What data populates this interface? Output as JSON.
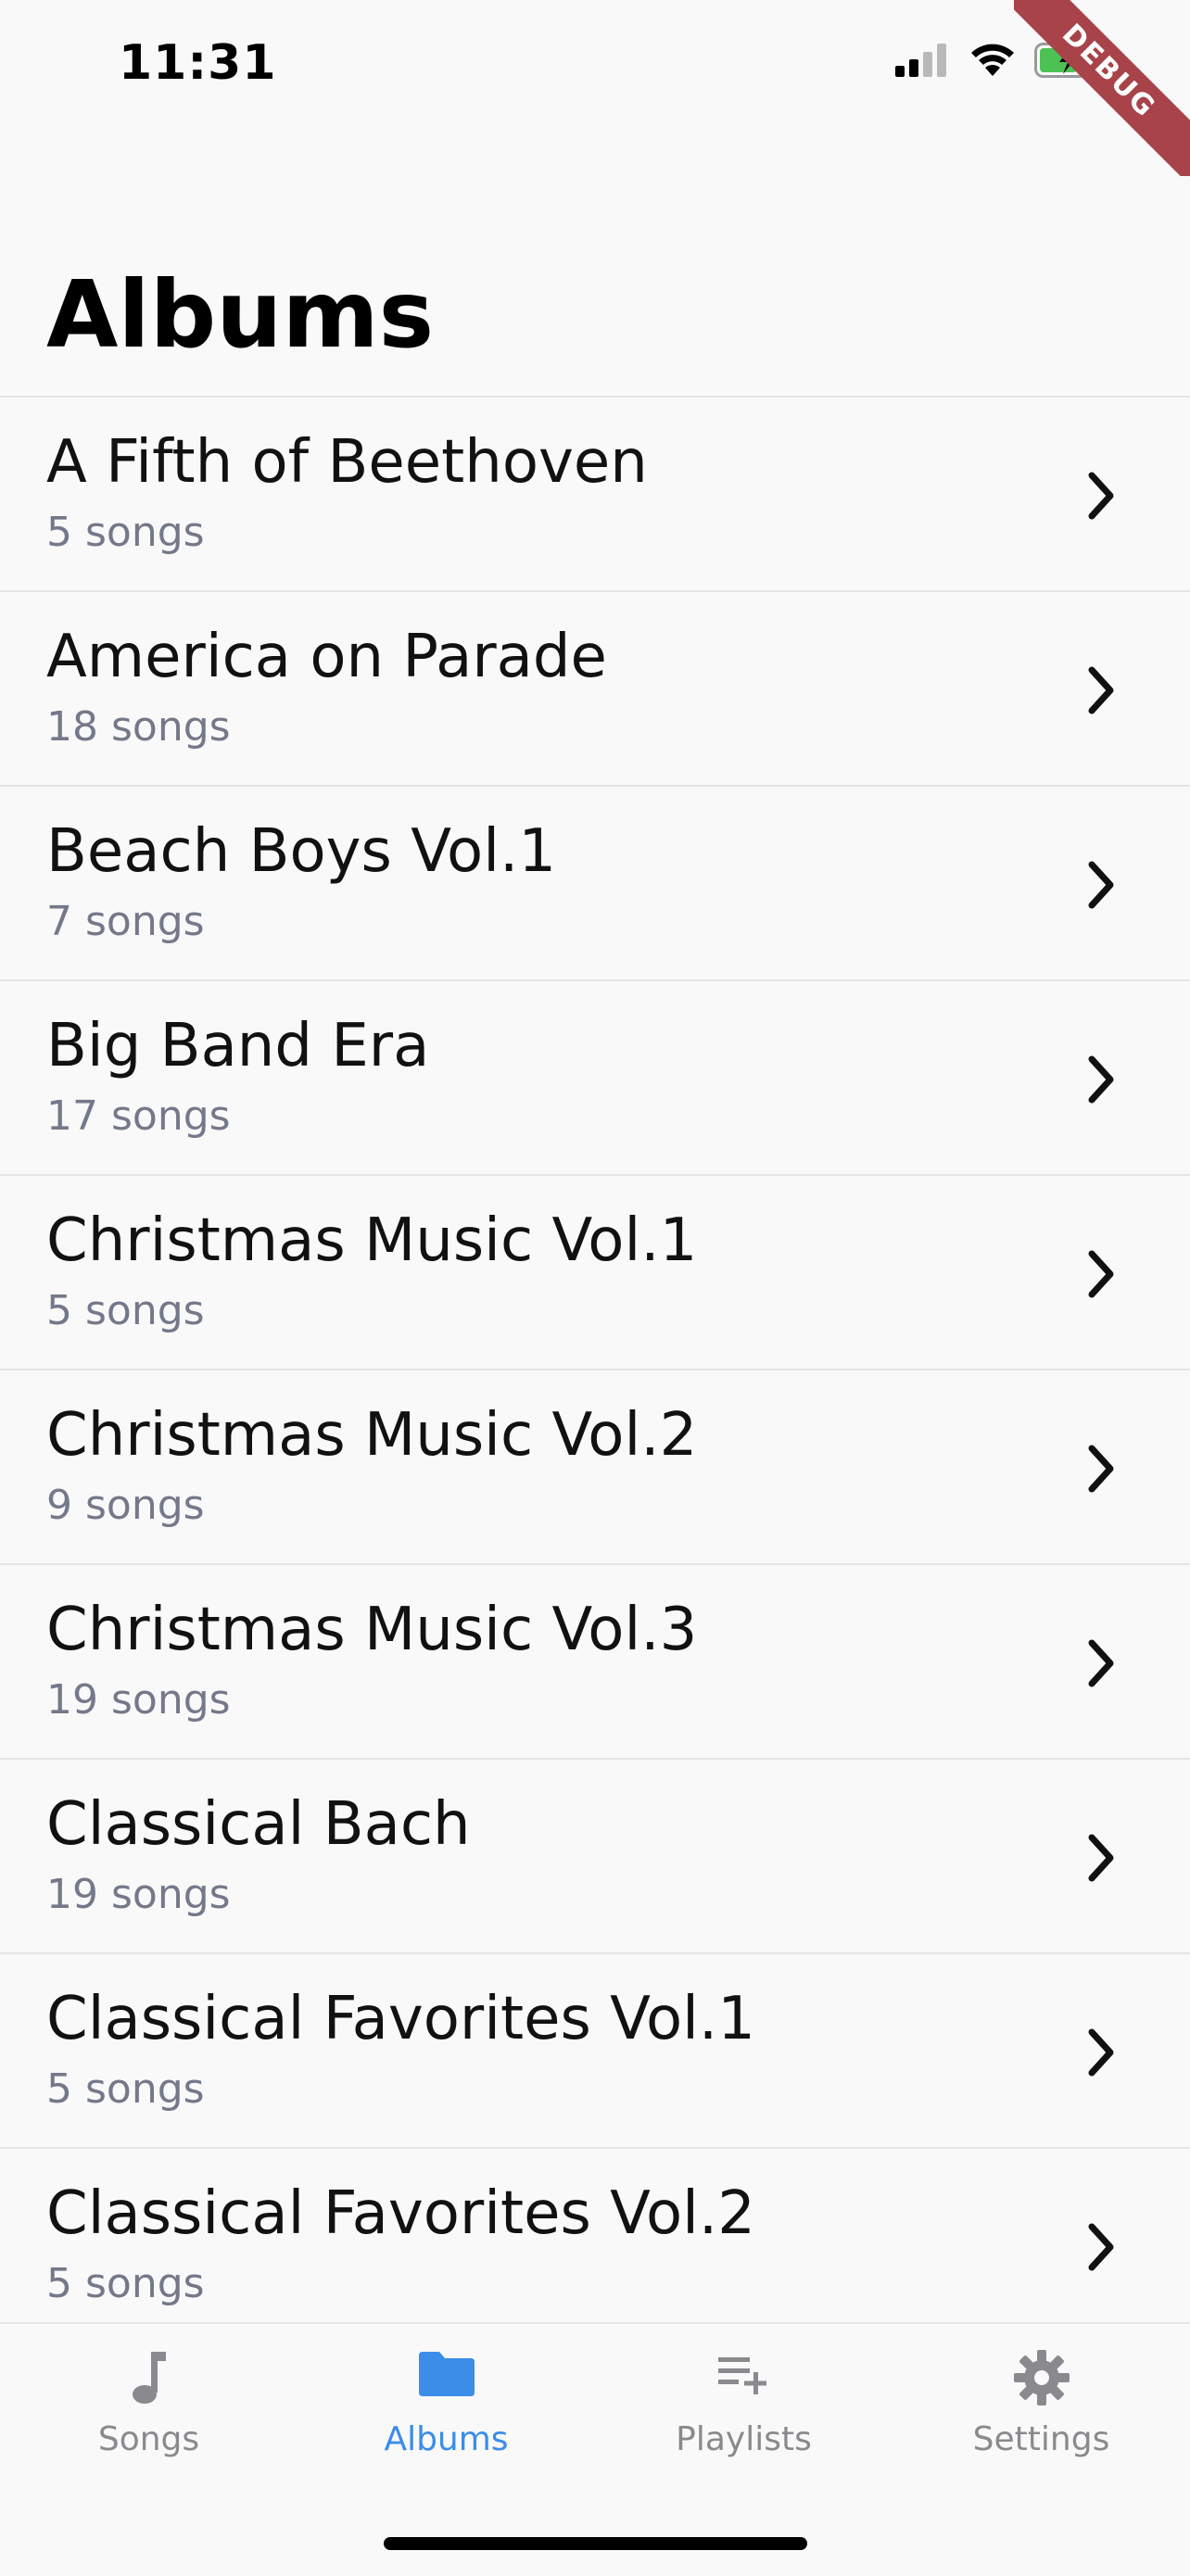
{
  "status": {
    "time": "11:31",
    "debug_label": "DEBUG"
  },
  "header": {
    "title": "Albums"
  },
  "albums": [
    {
      "title": "A Fifth of Beethoven",
      "count": "5 songs"
    },
    {
      "title": "America on Parade",
      "count": "18 songs"
    },
    {
      "title": "Beach Boys Vol.1",
      "count": "7 songs"
    },
    {
      "title": "Big Band Era",
      "count": "17 songs"
    },
    {
      "title": "Christmas Music Vol.1",
      "count": "5 songs"
    },
    {
      "title": "Christmas Music Vol.2",
      "count": "9 songs"
    },
    {
      "title": "Christmas Music Vol.3",
      "count": "19 songs"
    },
    {
      "title": "Classical Bach",
      "count": "19 songs"
    },
    {
      "title": "Classical Favorites Vol.1",
      "count": "5 songs"
    },
    {
      "title": "Classical Favorites Vol.2",
      "count": "5 songs"
    }
  ],
  "tabs": [
    {
      "label": "Songs",
      "icon": "music-note-icon",
      "active": false
    },
    {
      "label": "Albums",
      "icon": "folder-icon",
      "active": true
    },
    {
      "label": "Playlists",
      "icon": "playlist-add-icon",
      "active": false
    },
    {
      "label": "Settings",
      "icon": "gear-icon",
      "active": false
    }
  ],
  "colors": {
    "accent": "#3b8de8",
    "inactive": "#8a8a8e",
    "subtitle": "#74788a",
    "debug_ribbon": "#a8434a",
    "battery_fill": "#4cc254"
  }
}
